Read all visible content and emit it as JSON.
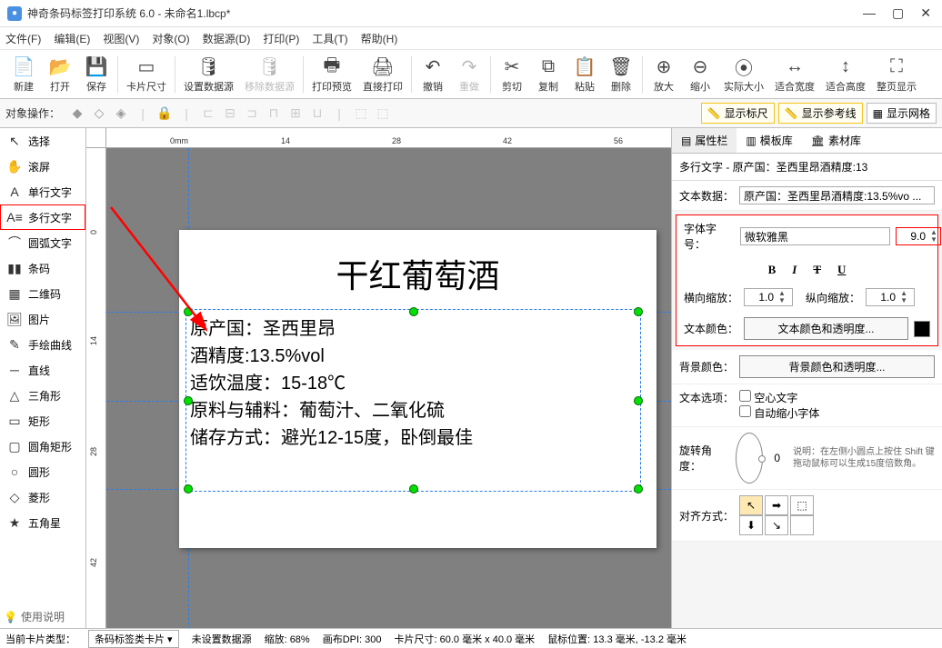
{
  "title": "神奇条码标签打印系统 6.0 - 未命名1.lbcp*",
  "menu": [
    "文件(F)",
    "编辑(E)",
    "视图(V)",
    "对象(O)",
    "数据源(D)",
    "打印(P)",
    "工具(T)",
    "帮助(H)"
  ],
  "toolbar": [
    {
      "label": "新建",
      "icon": "file"
    },
    {
      "label": "打开",
      "icon": "open"
    },
    {
      "label": "保存",
      "icon": "save"
    },
    "sep",
    {
      "label": "卡片尺寸",
      "icon": "size"
    },
    "sep",
    {
      "label": "设置数据源",
      "icon": "db"
    },
    {
      "label": "移除数据源",
      "icon": "dbx",
      "dis": true
    },
    "sep",
    {
      "label": "打印预览",
      "icon": "preview"
    },
    {
      "label": "直接打印",
      "icon": "print"
    },
    "sep",
    {
      "label": "撤销",
      "icon": "undo"
    },
    {
      "label": "重做",
      "icon": "redo",
      "dis": true
    },
    "sep",
    {
      "label": "剪切",
      "icon": "cut"
    },
    {
      "label": "复制",
      "icon": "copy"
    },
    {
      "label": "粘贴",
      "icon": "paste"
    },
    {
      "label": "删除",
      "icon": "del"
    },
    "sep",
    {
      "label": "放大",
      "icon": "zin"
    },
    {
      "label": "缩小",
      "icon": "zout"
    },
    {
      "label": "实际大小",
      "icon": "z1"
    },
    {
      "label": "适合宽度",
      "icon": "zfw"
    },
    {
      "label": "适合高度",
      "icon": "zfh"
    },
    {
      "label": "整页显示",
      "icon": "zfp"
    }
  ],
  "secbar": {
    "label": "对象操作：",
    "toggles": [
      {
        "label": "显示标尺",
        "hl": true
      },
      {
        "label": "显示参考线",
        "hl": true
      },
      {
        "label": "显示网格",
        "hl": false
      }
    ]
  },
  "palette": [
    {
      "label": "选择",
      "icon": "↖"
    },
    {
      "label": "滚屏",
      "icon": "✋"
    },
    {
      "label": "单行文字",
      "icon": "A"
    },
    {
      "label": "多行文字",
      "icon": "A≡",
      "sel": true
    },
    {
      "label": "圆弧文字",
      "icon": "⌒"
    },
    {
      "label": "条码",
      "icon": "▮▮"
    },
    {
      "label": "二维码",
      "icon": "▦"
    },
    {
      "label": "图片",
      "icon": "🖼"
    },
    {
      "label": "手绘曲线",
      "icon": "✎"
    },
    {
      "label": "直线",
      "icon": "─"
    },
    {
      "label": "三角形",
      "icon": "△"
    },
    {
      "label": "矩形",
      "icon": "▭"
    },
    {
      "label": "圆角矩形",
      "icon": "▢"
    },
    {
      "label": "圆形",
      "icon": "○"
    },
    {
      "label": "菱形",
      "icon": "◇"
    },
    {
      "label": "五角星",
      "icon": "★"
    }
  ],
  "help_label": "使用说明",
  "ruler_h": [
    "0mm",
    "14",
    "28",
    "42",
    "56"
  ],
  "ruler_v": [
    "0",
    "14",
    "28",
    "42"
  ],
  "card": {
    "heading": "干红葡萄酒",
    "lines": [
      "原产国：圣西里昂",
      "酒精度:13.5%vol",
      "适饮温度：15-18℃",
      "原料与辅料：葡萄汁、二氧化硫",
      "储存方式：避光12-15度，卧倒最佳"
    ]
  },
  "rpanel": {
    "tabs": [
      "属性栏",
      "模板库",
      "素材库"
    ],
    "obj_title": "多行文字 - 原产国：圣西里昂酒精度:13",
    "text_data_label": "文本数据：",
    "text_data_value": "原产国：圣西里昂酒精度:13.5%vo ...",
    "font_label": "字体字号：",
    "font_name": "微软雅黑",
    "font_size": "9.0",
    "hscale_label": "横向缩放：",
    "hscale": "1.0",
    "vscale_label": "纵向缩放：",
    "vscale": "1.0",
    "textcolor_label": "文本颜色：",
    "textcolor_btn": "文本颜色和透明度...",
    "bgcolor_label": "背景颜色：",
    "bgcolor_btn": "背景颜色和透明度...",
    "textopt_label": "文本选项：",
    "opt_hollow": "空心文字",
    "opt_autoshrink": "自动缩小字体",
    "rotate_label": "旋转角度：",
    "rotate_val": "0",
    "rotate_tip": "说明：在左侧小圆点上按住 Shift 键拖动鼠标可以生成15度倍数角。",
    "align_label": "对齐方式："
  },
  "status": {
    "card_type_label": "当前卡片类型：",
    "card_type": "条码标签类卡片",
    "ds": "未设置数据源",
    "zoom": "缩放: 68%",
    "dpi": "画布DPI: 300",
    "size": "卡片尺寸: 60.0 毫米 x 40.0 毫米",
    "mouse": "鼠标位置: 13.3 毫米, -13.2 毫米"
  }
}
